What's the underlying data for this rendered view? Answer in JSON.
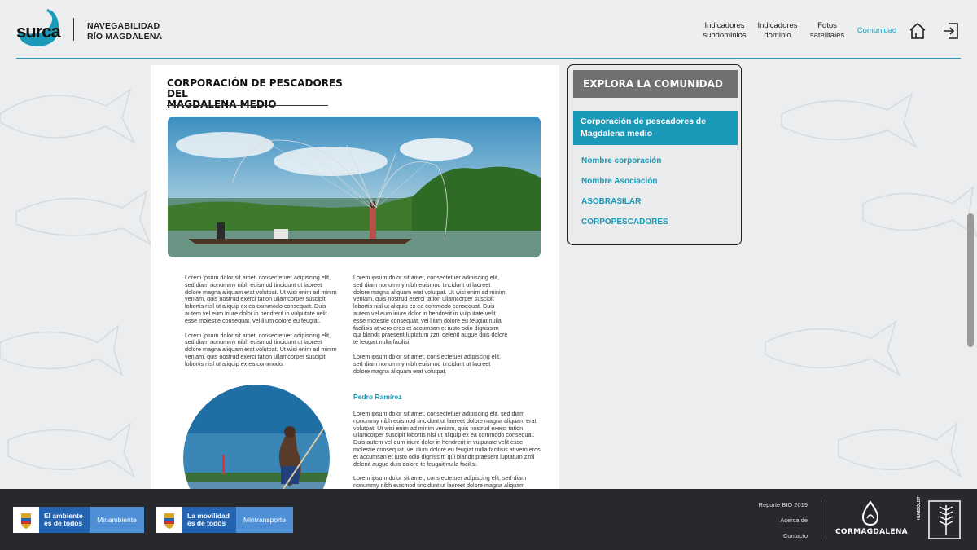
{
  "header": {
    "logo_text": "surca",
    "site_title_line1": "NAVEGABILIDAD",
    "site_title_line2": "RÍO MAGDALENA",
    "nav": [
      {
        "line1": "Indicadores",
        "line2": "subdominios"
      },
      {
        "line1": "Indicadores",
        "line2": "dominio"
      },
      {
        "line1": "Fotos",
        "line2": "satelitales"
      },
      {
        "line1": "Comunidad",
        "line2": ""
      }
    ],
    "home_icon": "home-icon",
    "logout_icon": "logout-icon"
  },
  "article": {
    "title_line1": "CORPORACIÓN DE PESCADORES DEL",
    "title_line2": "MAGDALENA MEDIO",
    "left_p1": "Lorem ipsum dolor sit amet, consectetuer adipiscing elit, sed diam nonummy nibh euismod tincidunt ut laoreet dolore magna aliquam erat volutpat. Ut wisi enim ad minim veniam, quis nostrud exerci tation ullamcorper suscipit lobortis nisl ut aliquip ex ea commodo consequat. Duis autem vel eum iriure dolor in hendrerit in vulputate velit esse molestie consequat, vel illum dolore eu feugiat.",
    "left_p2": "Lorem ipsum dolor sit amet, consectetuer adipiscing elit, sed diam nonummy nibh euismod tincidunt ut laoreet dolore magna aliquam erat volutpat. Ut wisi enim ad minim veniam, quis nostrud exerci tation ullamcorper suscipit lobortis nisl ut aliquip ex ea commodo.",
    "right_p1": "Lorem ipsum dolor sit amet, consectetuer adipiscing elit, sed diam nonummy nibh euismod tincidunt ut laoreet dolore magna aliquam erat volutpat. Ut wisi enim ad minim veniam, quis nostrud exerci tation ullamcorper suscipit lobortis nisl ut aliquip ex ea commodo consequat. Duis autem vel eum iriure dolor in hendrerit in vulputate velit esse molestie consequat, vel illum dolore eu feugiat nulla facilisis at vero eros et accumsan et iusto odio dignissim qui blandit praesent luptatum zzril delenit augue duis dolore te feugait nulla facilisi.",
    "right_p2": "Lorem ipsum dolor sit amet, cons ectetuer adipiscing elit, sed diam nonummy nibh euismod tincidunt ut laoreet dolore magna aliquam erat volutpat.",
    "person_name": "Pedro Ramírez",
    "bio_p1": "Lorem ipsum dolor sit amet, consectetuer adipiscing elit, sed diam nonummy nibh euismod tincidunt ut laoreet dolore magna aliquam erat volutpat. Ut wisi enim ad minim veniam, quis nostrud exerci tation ullamcorper suscipit lobortis nisl ut aliquip ex ea commodo consequat. Duis autem vel eum iriure dolor in hendrerit in vulputate velit esse molestie consequat, vel illum dolore eu feugiat nulla facilisis at vero eros et accumsan et iusto odio dignissim qui blandit praesent luptatum zzril delenit augue duis dolore te feugait nulla facilisi.",
    "bio_p2": "Lorem ipsum dolor sit amet, cons ectetuer adipiscing elit, sed diam nonummy nibh euismod tincidunt ut laoreet dolore magna aliquam"
  },
  "sidebar": {
    "heading": "EXPLORA LA COMUNIDAD",
    "active_item": "Corporación de pescadores de Magdalena medio",
    "links": [
      "Nombre corporación",
      "Nombre Asociación",
      "ASOBRASILAR",
      "CORPOPESCADORES"
    ]
  },
  "footer": {
    "badge1_line1": "El ambiente",
    "badge1_line2": "es de todos",
    "badge1_label": "Minambiente",
    "badge2_line1": "La movilidad",
    "badge2_line2": "es de todos",
    "badge2_label": "Mintransporte",
    "links": [
      "Reporte BIO 2019",
      "Acerca de",
      "Contacto"
    ],
    "cormagdalena": "CORMAGDALENA",
    "humboldt": "HUMBOLDT"
  },
  "colors": {
    "accent": "#1a9ab8",
    "footer": "#27292c",
    "sidebar_head": "#6f7072"
  }
}
